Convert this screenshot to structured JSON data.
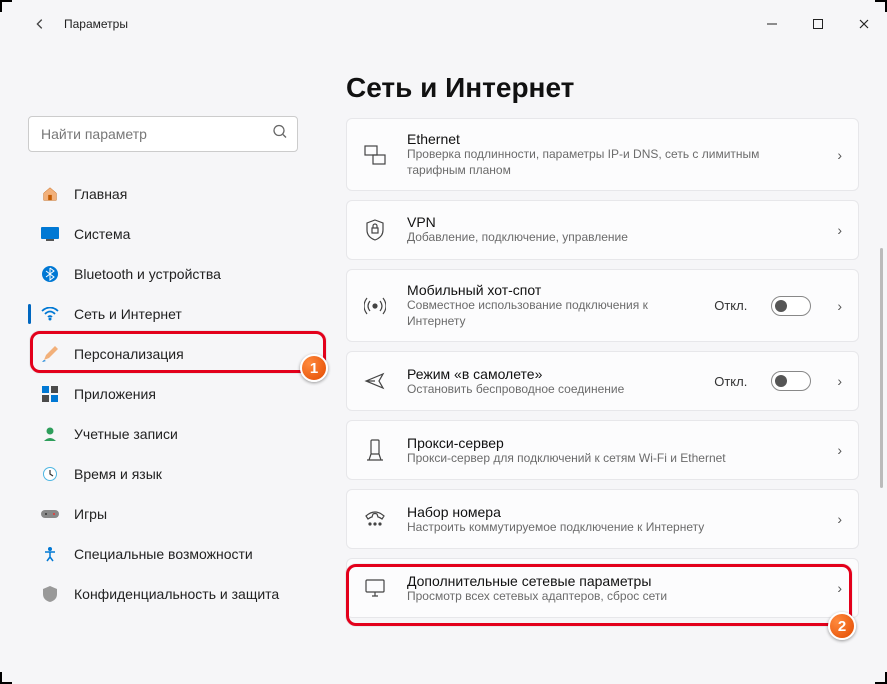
{
  "app_title": "Параметры",
  "search": {
    "placeholder": "Найти параметр"
  },
  "sidebar": {
    "items": [
      {
        "label": "Главная"
      },
      {
        "label": "Система"
      },
      {
        "label": "Bluetooth и устройства"
      },
      {
        "label": "Сеть и Интернет"
      },
      {
        "label": "Персонализация"
      },
      {
        "label": "Приложения"
      },
      {
        "label": "Учетные записи"
      },
      {
        "label": "Время и язык"
      },
      {
        "label": "Игры"
      },
      {
        "label": "Специальные возможности"
      },
      {
        "label": "Конфиденциальность и защита"
      }
    ]
  },
  "page": {
    "title": "Сеть и Интернет"
  },
  "cards": [
    {
      "title": "Ethernet",
      "desc": "Проверка подлинности, параметры IP-и DNS, сеть с лимитным тарифным планом"
    },
    {
      "title": "VPN",
      "desc": "Добавление, подключение, управление"
    },
    {
      "title": "Мобильный хот-спот",
      "desc": "Совместное использование подключения к Интернету",
      "state": "Откл.",
      "toggle": true
    },
    {
      "title": "Режим «в самолете»",
      "desc": "Остановить беспроводное соединение",
      "state": "Откл.",
      "toggle": true
    },
    {
      "title": "Прокси-сервер",
      "desc": "Прокси-сервер для подключений к сетям Wi-Fi и Ethernet"
    },
    {
      "title": "Набор номера",
      "desc": "Настроить коммутируемое подключение к Интернету"
    },
    {
      "title": "Дополнительные сетевые параметры",
      "desc": "Просмотр всех сетевых адаптеров, сброс сети"
    }
  ],
  "annotations": {
    "badge1": "1",
    "badge2": "2"
  }
}
